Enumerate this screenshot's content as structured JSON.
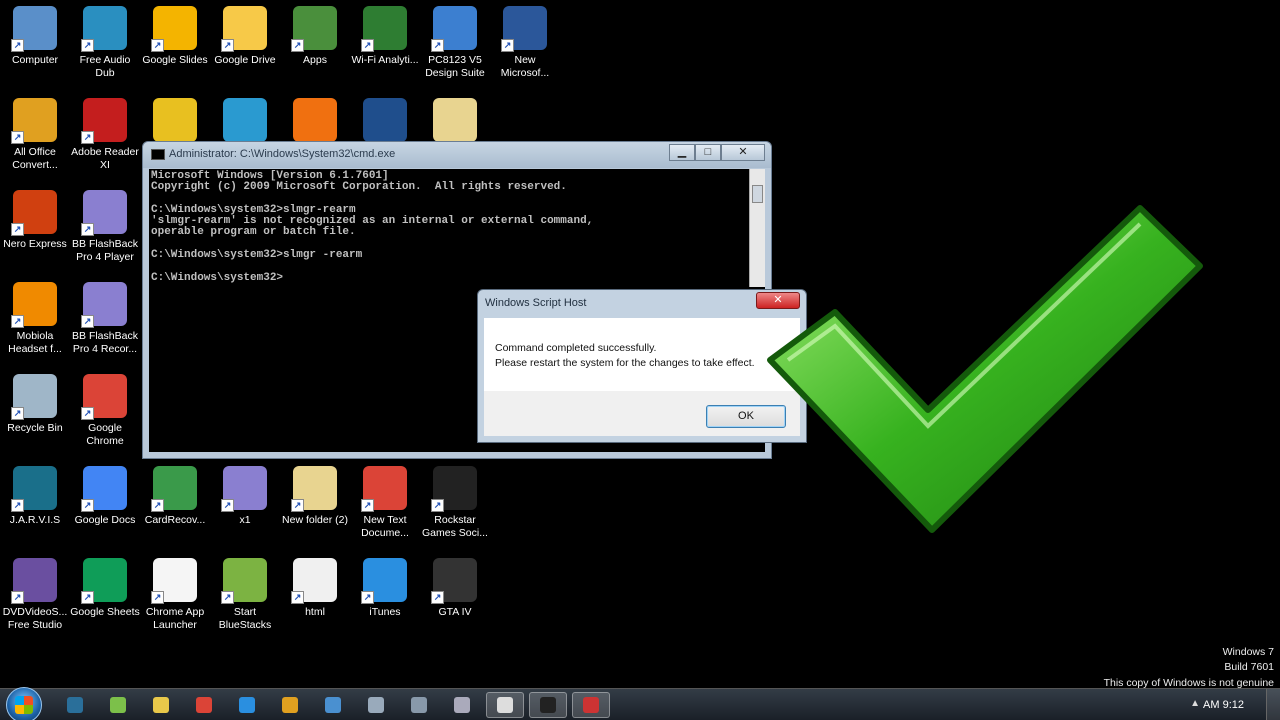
{
  "desktop_icons": [
    {
      "label": "Computer",
      "icon": "computer-icon",
      "color": "#5a8fc9"
    },
    {
      "label": "Free Audio Dub",
      "icon": "audio-dub-icon",
      "color": "#2a8fc0"
    },
    {
      "label": "Google Slides",
      "icon": "slides-icon",
      "color": "#f4b400"
    },
    {
      "label": "Google Drive",
      "icon": "drive-icon",
      "color": "#f7c948"
    },
    {
      "label": "Apps",
      "icon": "apps-icon",
      "color": "#4a8f3c"
    },
    {
      "label": "Wi-Fi Analyti...",
      "icon": "wifi-icon",
      "color": "#2e7d32"
    },
    {
      "label": "PC8123 V5 Design Suite",
      "icon": "design-suite-icon",
      "color": "#3c7fd0"
    },
    {
      "label": "New Microsof...",
      "icon": "word-doc-icon",
      "color": "#2b579a"
    },
    {
      "label": "All Office Convert...",
      "icon": "office-convert-icon",
      "color": "#e0a020"
    },
    {
      "label": "Adobe Reader XI",
      "icon": "pdf-icon",
      "color": "#c41e1e"
    },
    {
      "label": "Nero Express",
      "icon": "nero-icon",
      "color": "#d04010"
    },
    {
      "label": "BB FlashBack Pro 4 Player",
      "icon": "flashback-player-icon",
      "color": "#8a7fd0"
    },
    {
      "label": "Mobiola Headset f...",
      "icon": "headset-icon",
      "color": "#f08a00"
    },
    {
      "label": "BB FlashBack Pro 4 Recor...",
      "icon": "flashback-recorder-icon",
      "color": "#8a7fd0"
    },
    {
      "label": "Recycle Bin",
      "icon": "recycle-bin-icon",
      "color": "#9fb6c8"
    },
    {
      "label": "Google Chrome",
      "icon": "chrome-icon",
      "color": "#db4437"
    },
    {
      "label": "J.A.R.V.I.S",
      "icon": "jarvis-icon",
      "color": "#1a6f8a"
    },
    {
      "label": "Google Docs",
      "icon": "docs-icon",
      "color": "#4285f4"
    },
    {
      "label": "CardRecov...",
      "icon": "card-recovery-icon",
      "color": "#3a9a4a"
    },
    {
      "label": "x1",
      "icon": "x1-icon",
      "color": "#8a7fd0"
    },
    {
      "label": "New folder (2)",
      "icon": "folder-icon",
      "color": "#e8d490"
    },
    {
      "label": "New Text Docume...",
      "icon": "chrome-text-icon",
      "color": "#db4437"
    },
    {
      "label": "Rockstar Games Soci...",
      "icon": "rockstar-icon",
      "color": "#222222"
    },
    {
      "label": "DVDVideoS... Free Studio",
      "icon": "dvd-studio-icon",
      "color": "#6a4fa0"
    },
    {
      "label": "Google Sheets",
      "icon": "sheets-icon",
      "color": "#0f9d58"
    },
    {
      "label": "Chrome App Launcher",
      "icon": "app-launcher-icon",
      "color": "#f5f5f5"
    },
    {
      "label": "Start BlueStacks",
      "icon": "bluestacks-icon",
      "color": "#7cb342"
    },
    {
      "label": "html",
      "icon": "file-icon",
      "color": "#f0f0f0"
    },
    {
      "label": "iTunes",
      "icon": "itunes-icon",
      "color": "#2a8fe0"
    },
    {
      "label": "GTA IV",
      "icon": "gta-icon",
      "color": "#333333"
    }
  ],
  "partial_icons": [
    {
      "icon": "disc-icon",
      "color": "#e8c020"
    },
    {
      "icon": "internet-download-icon",
      "color": "#2a9ad0"
    },
    {
      "icon": "avast-icon",
      "color": "#f07010"
    },
    {
      "icon": "app-blue-icon",
      "color": "#1f4e8c"
    },
    {
      "icon": "folder-partial-icon",
      "color": "#e8d490"
    }
  ],
  "cmd_window": {
    "title": "Administrator: C:\\Windows\\System32\\cmd.exe",
    "lines": [
      "Microsoft Windows [Version 6.1.7601]",
      "Copyright (c) 2009 Microsoft Corporation.  All rights reserved.",
      "",
      "C:\\Windows\\system32>slmgr-rearm",
      "'slmgr-rearm' is not recognized as an internal or external command,",
      "operable program or batch file.",
      "",
      "C:\\Windows\\system32>slmgr -rearm",
      "",
      "C:\\Windows\\system32>"
    ],
    "minimize": "▁",
    "maximize": "□",
    "close": "✕"
  },
  "dialog": {
    "title": "Windows Script Host",
    "close": "✕",
    "message_1": "Command completed successfully.",
    "message_2": "Please restart the system for the changes to take effect.",
    "ok_label": "OK"
  },
  "watermark": {
    "line1": "Windows 7",
    "line2": "Build 7601",
    "line3": "This copy of Windows is not genuine"
  },
  "taskbar": {
    "items": [
      {
        "icon": "media-icon",
        "color": "#2a6f9a"
      },
      {
        "icon": "clock-app-icon",
        "color": "#7cc04a"
      },
      {
        "icon": "explorer-icon",
        "color": "#e8c84a"
      },
      {
        "icon": "chrome-task-icon",
        "color": "#db4437"
      },
      {
        "icon": "ie-icon",
        "color": "#2a8fe0"
      },
      {
        "icon": "app-task-icon",
        "color": "#e0a020"
      },
      {
        "icon": "window-task-icon",
        "color": "#4a90d0"
      },
      {
        "icon": "network-task-icon",
        "color": "#9ab"
      },
      {
        "icon": "keyboard-task-icon",
        "color": "#89a"
      },
      {
        "icon": "tool-task-icon",
        "color": "#aab"
      },
      {
        "icon": "rockstar-task-icon",
        "color": "#ddd"
      },
      {
        "icon": "cmd-task-icon",
        "color": "#222"
      },
      {
        "icon": "screen-task-icon",
        "color": "#c33"
      }
    ],
    "tray_arrow": "▲",
    "clock": "AM 9:12",
    "accent": "#1b61a6"
  },
  "check_color": "#37b21f"
}
